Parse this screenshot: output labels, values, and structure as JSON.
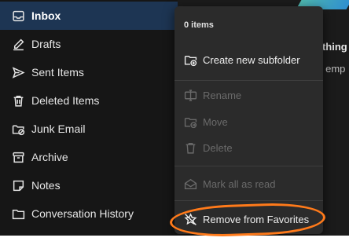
{
  "sidebar": {
    "folders": [
      {
        "label": "Inbox",
        "icon": "inbox-icon",
        "selected": true
      },
      {
        "label": "Drafts",
        "icon": "pencil-icon"
      },
      {
        "label": "Sent Items",
        "icon": "send-icon"
      },
      {
        "label": "Deleted Items",
        "icon": "trash-icon"
      },
      {
        "label": "Junk Email",
        "icon": "junk-folder-icon"
      },
      {
        "label": "Archive",
        "icon": "archive-icon"
      },
      {
        "label": "Notes",
        "icon": "note-icon"
      },
      {
        "label": "Conversation History",
        "icon": "folder-icon"
      }
    ]
  },
  "reading_pane": {
    "partial_title": "othing",
    "partial_text": "s emp"
  },
  "context_menu": {
    "header": "0 items",
    "items": [
      {
        "label": "Create new subfolder",
        "icon": "new-folder-icon",
        "enabled": true
      },
      {
        "label": "Rename",
        "icon": "rename-icon",
        "enabled": false
      },
      {
        "label": "Move",
        "icon": "move-folder-icon",
        "enabled": false
      },
      {
        "label": "Delete",
        "icon": "trash-icon",
        "enabled": false
      },
      {
        "label": "Mark all as read",
        "icon": "mark-read-icon",
        "enabled": false
      },
      {
        "label": "Remove from Favorites",
        "icon": "star-remove-icon",
        "enabled": true
      }
    ]
  },
  "colors": {
    "selected_bg": "#1d3553",
    "menu_bg": "#2b2b2b",
    "annotation": "#ff7a1a"
  }
}
